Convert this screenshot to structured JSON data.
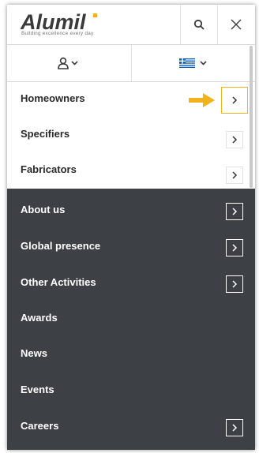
{
  "header": {
    "logo_text": "Alumil",
    "tagline": "Building excellence every day",
    "search_icon": "search-icon",
    "close_icon": "close-icon"
  },
  "subbar": {
    "user_icon": "user-icon",
    "language_icon": "greek-flag-icon"
  },
  "menu_primary": [
    {
      "label": "Homeowners",
      "has_submenu": true
    },
    {
      "label": "Specifiers",
      "has_submenu": true
    },
    {
      "label": "Fabricators",
      "has_submenu": true
    }
  ],
  "menu_secondary": [
    {
      "label": "About us",
      "has_submenu": true
    },
    {
      "label": "Global presence",
      "has_submenu": true
    },
    {
      "label": "Other Activities",
      "has_submenu": true
    },
    {
      "label": "Awards",
      "has_submenu": false
    },
    {
      "label": "News",
      "has_submenu": false
    },
    {
      "label": "Events",
      "has_submenu": false
    },
    {
      "label": "Careers",
      "has_submenu": true
    }
  ],
  "colors": {
    "dark_bg": "#3d4146",
    "highlight": "#f2b21b",
    "text_dark": "#2a2a2a",
    "text_light": "#ffffff"
  }
}
